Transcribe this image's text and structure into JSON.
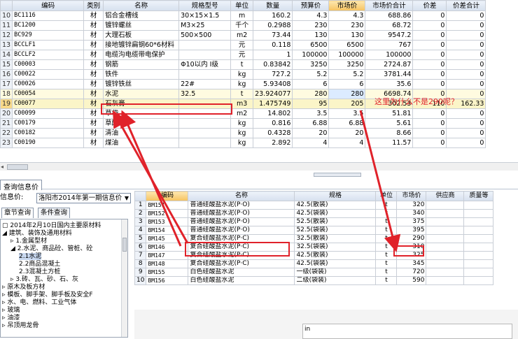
{
  "top_grid": {
    "columns": [
      "",
      "编码",
      "类别",
      "名称",
      "规格型号",
      "单位",
      "数量",
      "预算价",
      "市场价",
      "市场价合计",
      "价差",
      "价差合计"
    ],
    "rows": [
      [
        "10",
        "BC1116",
        "材",
        "铝合金槽线",
        "30×15×1.5",
        "m",
        "160.2",
        "4.3",
        "4.3",
        "688.86",
        "0",
        "0"
      ],
      [
        "11",
        "BC1200",
        "材",
        "镀锌螺丝",
        "M3×25",
        "千个",
        "0.2988",
        "230",
        "230",
        "68.72",
        "0",
        "0"
      ],
      [
        "12",
        "BC929",
        "材",
        "大理石板",
        "500×500",
        "m2",
        "73.44",
        "130",
        "130",
        "9547.2",
        "0",
        "0"
      ],
      [
        "13",
        "BCCLF1",
        "材",
        "接地镀锌扁钢60*6材料",
        "",
        "元",
        "0.118",
        "6500",
        "6500",
        "767",
        "0",
        "0"
      ],
      [
        "14",
        "BCCLF2",
        "材",
        "电缆沟电缆带电保护",
        "",
        "元",
        "1",
        "100000",
        "100000",
        "100000",
        "0",
        "0"
      ],
      [
        "15",
        "C00003",
        "材",
        "钢筋",
        "Φ10以内 I级",
        "t",
        "0.83842",
        "3250",
        "3250",
        "2724.87",
        "0",
        "0"
      ],
      [
        "16",
        "C00022",
        "材",
        "铁件",
        "",
        "kg",
        "727.2",
        "5.2",
        "5.2",
        "3781.44",
        "0",
        "0"
      ],
      [
        "17",
        "C00026",
        "材",
        "镀锌铁丝",
        "22#",
        "kg",
        "5.93408",
        "6",
        "6",
        "35.6",
        "0",
        "0"
      ],
      [
        "18",
        "C00054",
        "材",
        "水泥",
        "32.5",
        "t",
        "23.924077",
        "280",
        "280",
        "6698.74",
        "0",
        "0"
      ],
      [
        "19",
        "C00077",
        "材",
        "石灰膏",
        "",
        "m3",
        "1.475749",
        "95",
        "205",
        "302.53",
        "110",
        "162.33"
      ],
      [
        "20",
        "C00099",
        "材",
        "草袋",
        "",
        "m2",
        "14.802",
        "3.5",
        "3.5",
        "51.81",
        "0",
        "0"
      ],
      [
        "21",
        "C00179",
        "材",
        "草酸",
        "",
        "kg",
        "0.816",
        "6.88",
        "6.88",
        "5.61",
        "0",
        "0"
      ],
      [
        "22",
        "C00182",
        "材",
        "清油",
        "",
        "kg",
        "0.4328",
        "20",
        "20",
        "8.66",
        "0",
        "0"
      ],
      [
        "23",
        "C00190",
        "材",
        "煤油",
        "",
        "kg",
        "2.892",
        "4",
        "4",
        "11.57",
        "0",
        "0"
      ]
    ]
  },
  "annotation": {
    "text": "这里为什么不是290呢？",
    "color": "#e0222a"
  },
  "bottom": {
    "tab_label": "查询信息价",
    "info_label": "信息价:",
    "price_source": "洛阳市2014年第一期信息价",
    "chapter_tab": "章节查询",
    "condition_tab": "条件查询",
    "tree": [
      "2014年2月10日国内主要原材料",
      "建筑、装饰及通用材料",
      "1.金属型材",
      "2.水泥、商品砼、管桩、砼",
      "2.1水泥",
      "2.2商品混凝土",
      "2.3混凝土方桩",
      "3.砖、瓦、砂、石、灰",
      "原木及板方材",
      "模板、脚手架、脚手板及安全F",
      "水、电、燃料、工业气体",
      "玻璃",
      "油漆",
      "吊顶用龙骨"
    ],
    "columns": [
      "",
      "编码",
      "名称",
      "规格",
      "单位",
      "市场价",
      "供应商",
      "质量等"
    ],
    "rows": [
      [
        "1",
        "BM151",
        "普通硅酸盐水泥(P·O)",
        "42.5(散装)",
        "t",
        "320",
        "",
        ""
      ],
      [
        "2",
        "BM152",
        "普通硅酸盐水泥(P·O)",
        "42.5(袋装)",
        "t",
        "340",
        "",
        ""
      ],
      [
        "3",
        "BM153",
        "普通硅酸盐水泥(P·O)",
        "52.5(散装)",
        "t",
        "375",
        "",
        ""
      ],
      [
        "4",
        "BM154",
        "普通硅酸盐水泥(P·O)",
        "52.5(袋装)",
        "t",
        "395",
        "",
        ""
      ],
      [
        "5",
        "BM145",
        "复合硅酸盐水泥(P·C)",
        "32.5(散装)",
        "t",
        "290",
        "",
        ""
      ],
      [
        "6",
        "BM146",
        "复合硅酸盐水泥(P·C)",
        "32.5(袋装)",
        "t",
        "310",
        "",
        ""
      ],
      [
        "7",
        "BM147",
        "复合硅酸盐水泥(P·C)",
        "42.5(散装)",
        "t",
        "325",
        "",
        ""
      ],
      [
        "8",
        "BM148",
        "复合硅酸盐水泥(P·C)",
        "42.5(袋装)",
        "t",
        "345",
        "",
        ""
      ],
      [
        "9",
        "BM155",
        "白色硅酸盐水泥",
        "一级(袋装)",
        "t",
        "720",
        "",
        ""
      ],
      [
        "10",
        "BM156",
        "白色硅酸盐水泥",
        "二级(袋装)",
        "t",
        "590",
        "",
        ""
      ]
    ]
  },
  "widget_text": "in"
}
